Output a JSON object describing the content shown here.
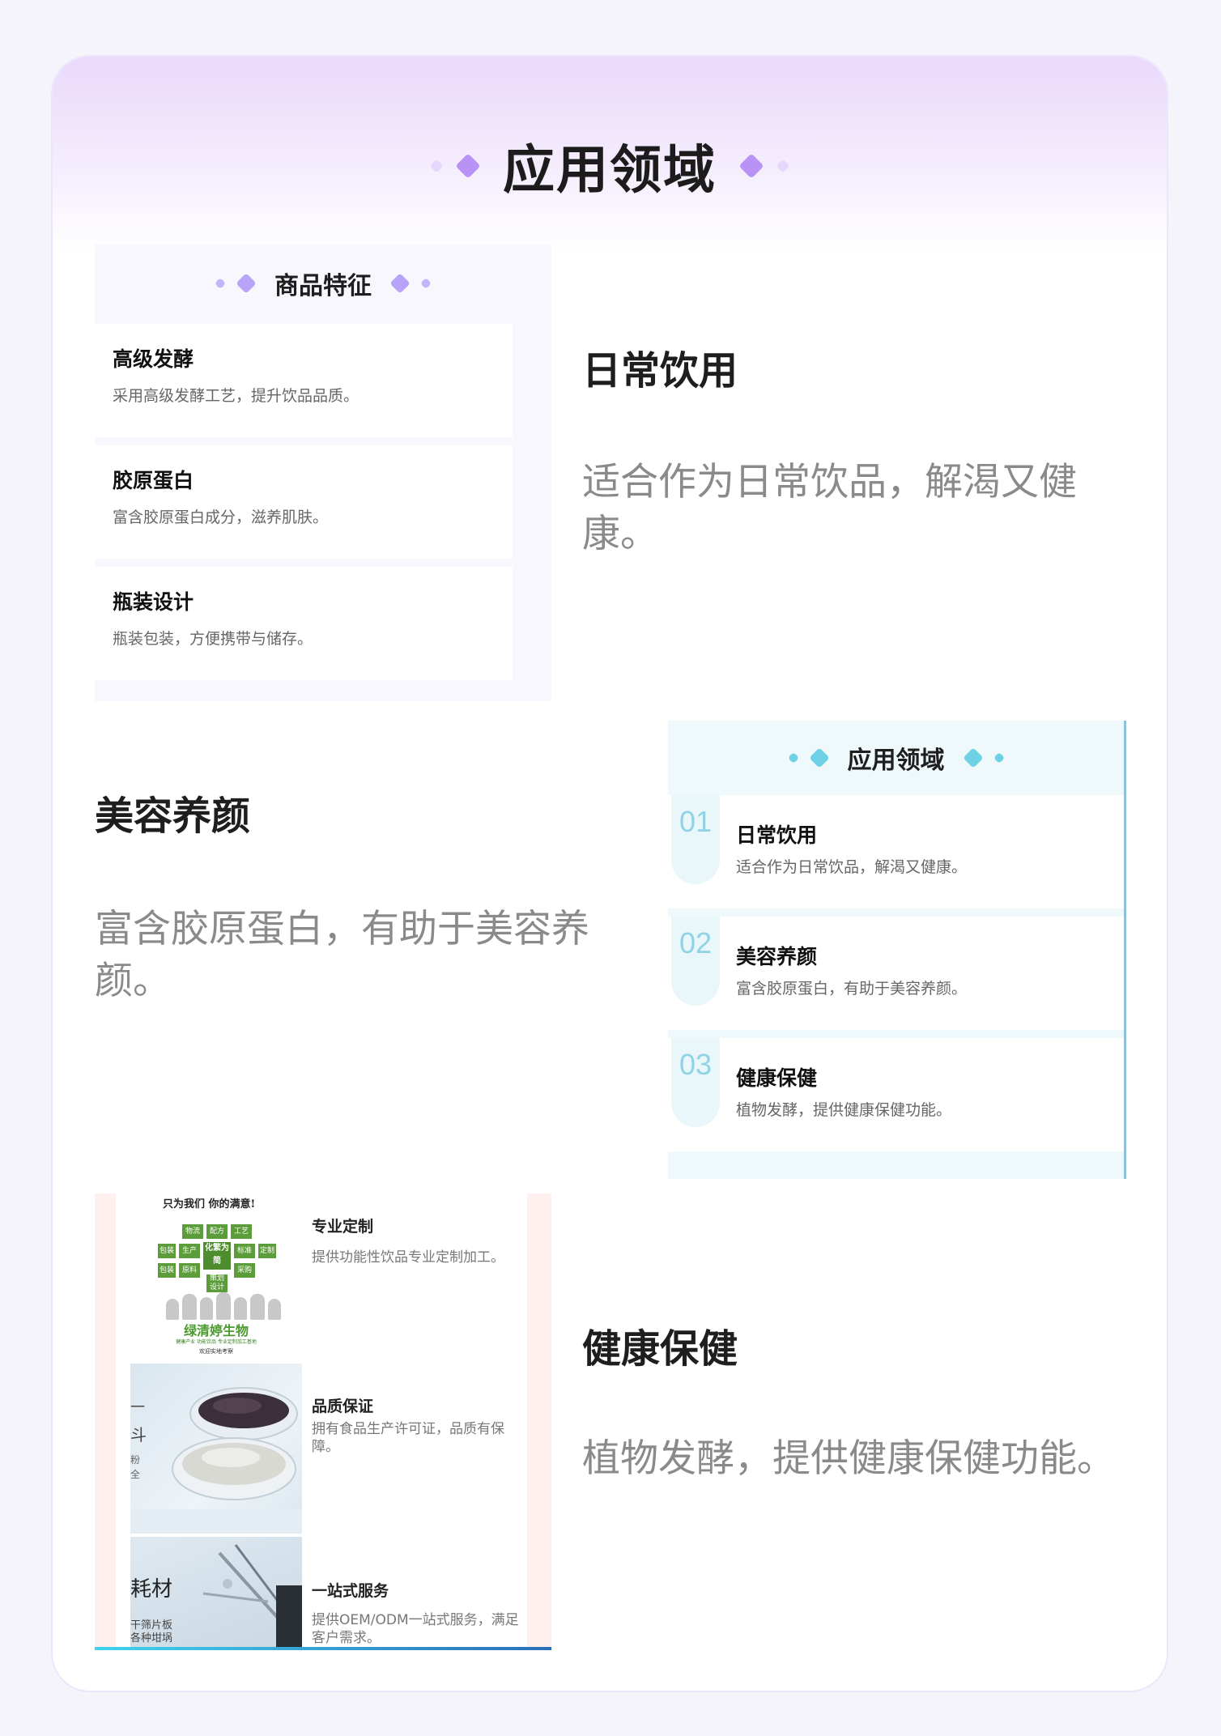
{
  "header": {
    "title": "应用领域"
  },
  "features": {
    "title": "商品特征",
    "items": [
      {
        "title": "高级发酵",
        "desc": "采用高级发酵工艺，提升饮品品质。"
      },
      {
        "title": "胶原蛋白",
        "desc": "富含胶原蛋白成分，滋养肌肤。"
      },
      {
        "title": "瓶装设计",
        "desc": "瓶装包装，方便携带与储存。"
      }
    ]
  },
  "sections": [
    {
      "title": "日常饮用",
      "desc": "适合作为日常饮品，解渴又健康。"
    },
    {
      "title": "美容养颜",
      "desc": "富含胶原蛋白，有助于美容养颜。"
    },
    {
      "title": "健康保健",
      "desc": "植物发酵，提供健康保健功能。"
    }
  ],
  "applications": {
    "title": "应用领域",
    "items": [
      {
        "num": "01",
        "title": "日常饮用",
        "desc": "适合作为日常饮品，解渴又健康。"
      },
      {
        "num": "02",
        "title": "美容养颜",
        "desc": "富含胶原蛋白，有助于美容养颜。"
      },
      {
        "num": "03",
        "title": "健康保健",
        "desc": "植物发酵，提供健康保健功能。"
      }
    ]
  },
  "services": {
    "items": [
      {
        "title": "专业定制",
        "desc": "提供功能性饮品专业定制加工。"
      },
      {
        "title": "品质保证",
        "desc": "拥有食品生产许可证，品质有保障。"
      },
      {
        "title": "一站式服务",
        "desc": "提供OEM/ODM一站式服务，满足客户需求。"
      }
    ],
    "image1": {
      "slogan": "只为我们 你的满意!",
      "boxes": [
        "物流",
        "配方",
        "工艺",
        "包装",
        "化繁为简",
        "标准",
        "生产",
        "定制",
        "原料",
        "策划设计",
        "采购",
        "包装"
      ],
      "brand": "绿清婷生物",
      "tagline": "健康产业 功能饮品 专业定制加工基地",
      "sub": "欢迎实地考察"
    },
    "image2": {
      "side_text": [
        "一",
        "斗",
        "粉",
        "全"
      ]
    },
    "image3": {
      "side_text": "耗材",
      "side_sub": [
        "干筛片板",
        "各种坩埚"
      ]
    }
  },
  "colors": {
    "accent_purple": "#a98cf5",
    "accent_purple_light": "#d8c9fb",
    "accent_cyan": "#6fd1e6",
    "accent_cyan_light": "#a9e5f1",
    "number_color": "#8fd3e4"
  }
}
